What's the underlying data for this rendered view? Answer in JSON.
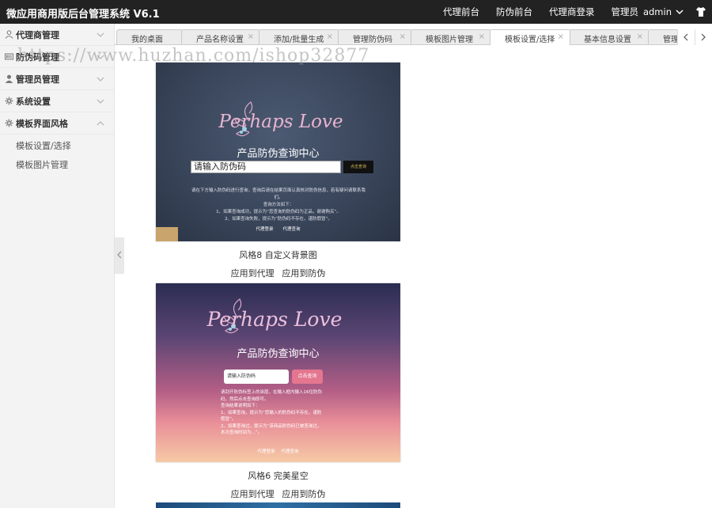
{
  "app": {
    "title": "微应用商用版后台管理系统 V6.1",
    "nav": [
      "代理前台",
      "防伪前台",
      "代理商登录"
    ],
    "role_label": "管理员",
    "username": "admin"
  },
  "sidebar": {
    "items": [
      {
        "label": "代理商管理",
        "icon": "user-icon"
      },
      {
        "label": "防伪码管理",
        "icon": "barcode-icon"
      },
      {
        "label": "管理员管理",
        "icon": "admin-icon"
      },
      {
        "label": "系统设置",
        "icon": "gear-icon"
      },
      {
        "label": "模板界面风格",
        "icon": "gear-icon",
        "expanded": true
      }
    ],
    "submenu": [
      "模板设置/选择",
      "模板图片管理"
    ]
  },
  "tabs": [
    {
      "label": "我的桌面"
    },
    {
      "label": "产品名称设置"
    },
    {
      "label": "添加/批量生成"
    },
    {
      "label": "管理防伪码"
    },
    {
      "label": "模板图片管理"
    },
    {
      "label": "模板设置/选择",
      "active": true
    },
    {
      "label": "基本信息设置"
    },
    {
      "label": "管理代"
    }
  ],
  "tab_close_glyph": "×",
  "watermark": "https://www.huzhan.com/ishop32877",
  "templates": [
    {
      "caption": "风格8 自定义背景图",
      "actions": [
        "应用到代理",
        "应用到防伪"
      ],
      "preview": {
        "logo_text": "Perhaps Love",
        "title": "产品防伪查询中心",
        "input_placeholder": "请输入防伪码",
        "button_label": "点击查询",
        "lines": [
          "请在下方输入防伪码进行查询，查询后请在结果页面认真核对防伪信息，若有疑问请联系我们。",
          "查询方法如下：",
          "1、如果查询成功，提示为“您查询的防伪码为正品，谢谢购买”。",
          "2、如果查询失败，提示为“防伪码不存在，谨防假冒”。"
        ],
        "links": [
          "代理登录",
          "代理查询"
        ]
      }
    },
    {
      "caption": "风格6 完美星空",
      "actions": [
        "应用到代理",
        "应用到防伪"
      ],
      "preview": {
        "logo_text": "Perhaps Love",
        "title": "产品防伪查询中心",
        "input_placeholder": "请输入防伪码",
        "button_label": "点击查询",
        "lines": [
          "请刮开防伪标签上的涂层，在输入框内输入16位防伪码，然后点击查询即可。",
          "查询结果说明如下：",
          "1、如果查询，提示为“您输入的防伪码不存在，谨防假冒”。",
          "2、如果查询过，提示为“该商品防伪码已被查询过，本次查询时间为...”。"
        ],
        "links": [
          "代理登录",
          "代理查询"
        ]
      }
    }
  ],
  "colors": {
    "topbar": "#222222",
    "sidebar": "#f3f3f3",
    "accent_gold": "#d9b95c",
    "accent_pink": "#e4768f"
  }
}
